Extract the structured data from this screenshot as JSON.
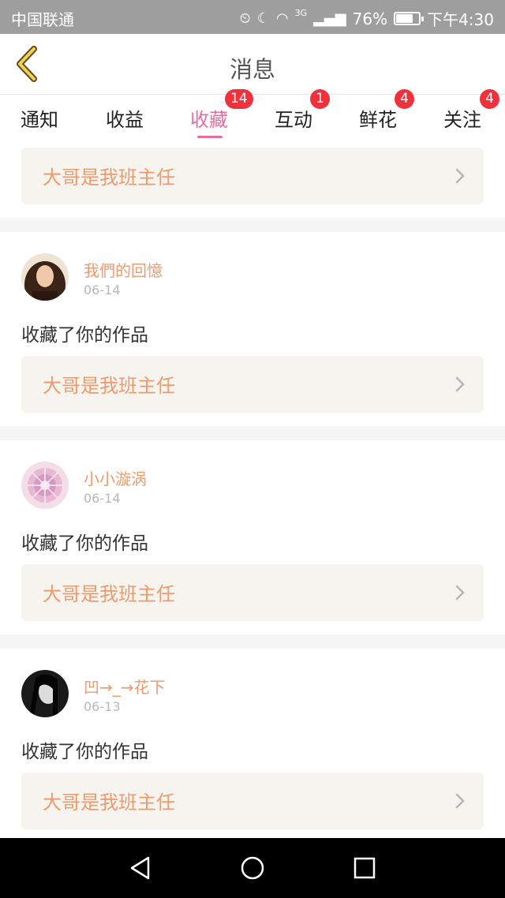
{
  "status": {
    "carrier": "中国联通",
    "network": "3G",
    "battery_pct": "76%",
    "battery_level": 0.76,
    "time": "下午4:30"
  },
  "header": {
    "title": "消息"
  },
  "tabs": [
    {
      "label": "通知",
      "badge": ""
    },
    {
      "label": "收益",
      "badge": ""
    },
    {
      "label": "收藏",
      "badge": "14",
      "active": true
    },
    {
      "label": "互动",
      "badge": "1"
    },
    {
      "label": "鲜花",
      "badge": "4"
    },
    {
      "label": "关注",
      "badge": "4"
    }
  ],
  "top_card": {
    "title": "大哥是我班主任"
  },
  "items": [
    {
      "user": "我們的回憶",
      "date": "06-14",
      "message": "收藏了你的作品",
      "work": "大哥是我班主任"
    },
    {
      "user": "小小漩涡",
      "date": "06-14",
      "message": "收藏了你的作品",
      "work": "大哥是我班主任"
    },
    {
      "user": "凹→_→花下",
      "date": "06-13",
      "message": "收藏了你的作品",
      "work": "大哥是我班主任"
    }
  ],
  "colors": {
    "accent_pink": "#e56fa0",
    "orange_text": "#ee9a6c",
    "badge_red": "#f0303a",
    "card_bg": "#f5f4ee"
  }
}
